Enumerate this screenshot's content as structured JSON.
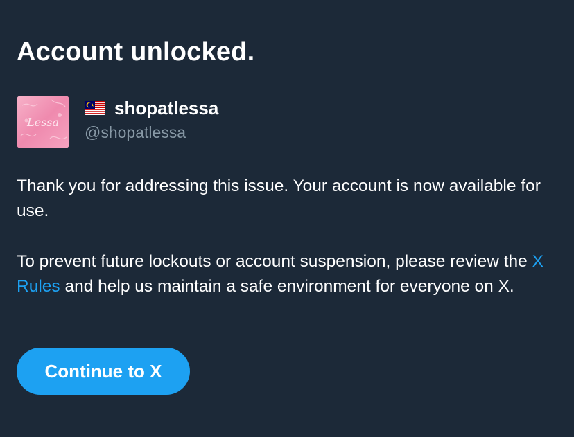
{
  "title": "Account unlocked.",
  "account": {
    "flag_icon": "malaysia-flag-icon",
    "display_name": "shopatlessa",
    "handle": "@shopatlessa",
    "avatar_text": "Lessa"
  },
  "body": {
    "paragraph1": "Thank you for addressing this issue. Your account is now available for use.",
    "paragraph2_before": "To prevent future lockouts or account suspension, please review the ",
    "paragraph2_link": "X Rules",
    "paragraph2_after": " and help us maintain a safe environment for everyone on X."
  },
  "button": {
    "label": "Continue to X"
  },
  "colors": {
    "background": "#1c2938",
    "accent": "#1da1f2",
    "secondary_text": "#8899a6",
    "avatar_pink": "#f28db0"
  }
}
